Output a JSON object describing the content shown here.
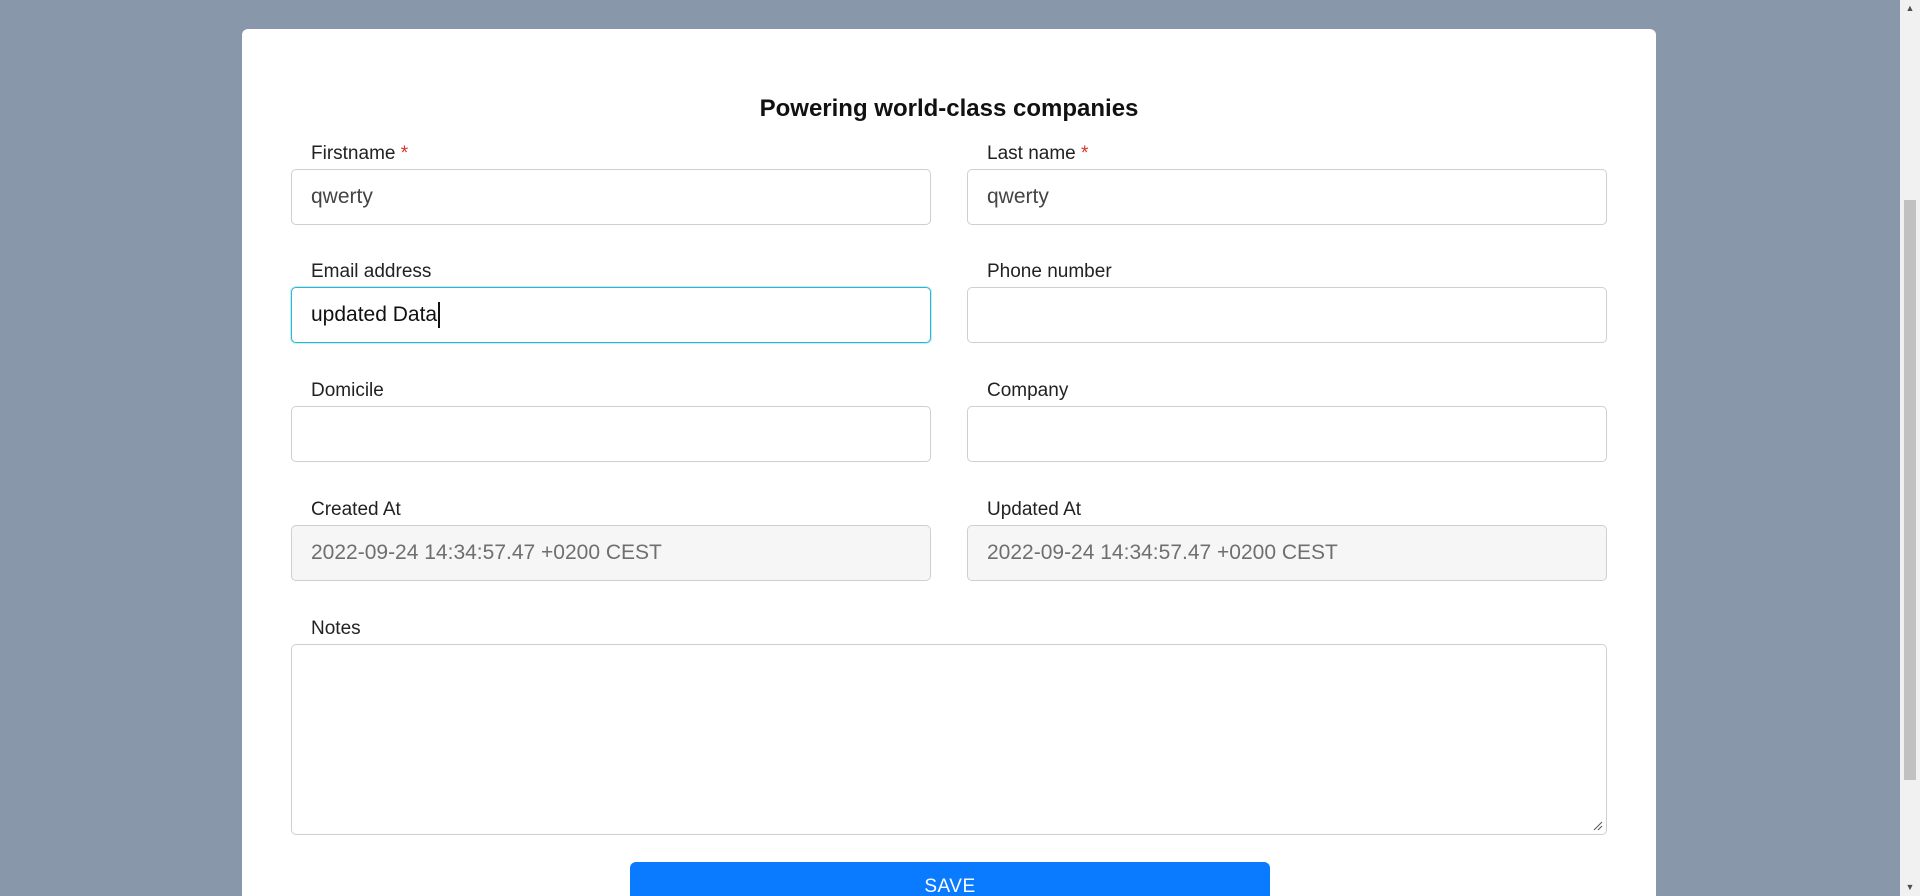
{
  "form": {
    "title": "Powering world-class companies",
    "required_marker": "*",
    "firstname": {
      "label": "Firstname",
      "value": "qwerty"
    },
    "lastname": {
      "label": "Last name",
      "value": "qwerty"
    },
    "email": {
      "label": "Email address",
      "value": "updated Data"
    },
    "phone": {
      "label": "Phone number",
      "value": ""
    },
    "domicile": {
      "label": "Domicile",
      "value": ""
    },
    "company": {
      "label": "Company",
      "value": ""
    },
    "created_at": {
      "label": "Created At",
      "value": "2022-09-24 14:34:57.47 +0200 CEST"
    },
    "updated_at": {
      "label": "Updated At",
      "value": "2022-09-24 14:34:57.47 +0200 CEST"
    },
    "notes": {
      "label": "Notes",
      "value": ""
    },
    "save_label": "SAVE"
  },
  "icons": {
    "scroll_up": "scroll-up-arrow-icon",
    "scroll_down": "scroll-down-arrow-icon",
    "resize": "resize-handle-icon"
  },
  "colors": {
    "background": "#8897aa",
    "primary_button": "#0a7aff",
    "focus_border": "#26b7d4",
    "required": "#d9302c"
  }
}
